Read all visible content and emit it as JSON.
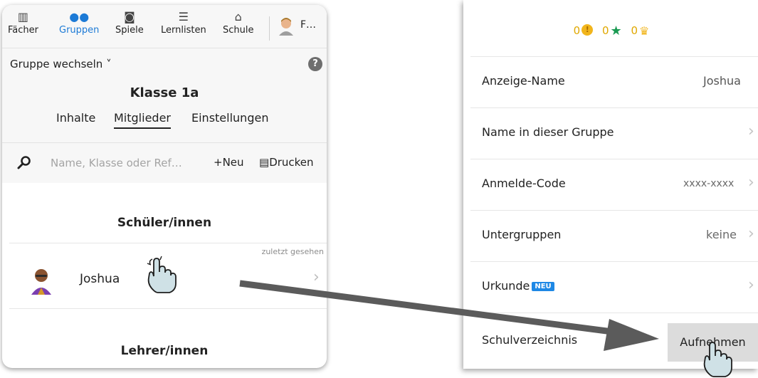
{
  "nav": {
    "items": [
      {
        "label": "Fächer",
        "icon": "books-icon",
        "glyph": "▥"
      },
      {
        "label": "Gruppen",
        "icon": "group-icon",
        "glyph": "●●",
        "active": true
      },
      {
        "label": "Spiele",
        "icon": "gamepad-icon",
        "glyph": "◙"
      },
      {
        "label": "Lernlisten",
        "icon": "list-icon",
        "glyph": "☰"
      },
      {
        "label": "Schule",
        "icon": "school-icon",
        "glyph": "⌂"
      }
    ],
    "user_label": "F…"
  },
  "group_switch": "Gruppe wechseln ˅",
  "help": "?",
  "class_title": "Klasse 1a",
  "tabs": [
    "Inhalte",
    "Mitglieder",
    "Einstellungen"
  ],
  "search": {
    "placeholder": "Name, Klasse oder Ref…"
  },
  "actions": {
    "new": "+Neu",
    "print": "Drucken"
  },
  "students": {
    "heading": "Schüler/innen",
    "last_seen_label": "zuletzt gesehen",
    "items": [
      {
        "name": "Joshua"
      }
    ]
  },
  "teachers": {
    "heading": "Lehrer/innen"
  },
  "profile": {
    "stats": {
      "coins": "0",
      "stars": "0",
      "trophies": "0"
    },
    "rows": [
      {
        "label": "Anzeige-Name",
        "value": "Joshua"
      },
      {
        "label": "Name in dieser Gruppe",
        "value": ""
      },
      {
        "label": "Anmelde-Code",
        "value": "xxxx-xxxx"
      },
      {
        "label": "Untergruppen",
        "value": "keine"
      },
      {
        "label": "Urkunde",
        "badge": "NEU",
        "value": ""
      },
      {
        "label": "Schulverzeichnis",
        "button": "Aufnehmen"
      }
    ]
  },
  "colors": {
    "accent": "#1c7ad6",
    "badge": "#1e88e5",
    "coin": "#f1b51c",
    "star": "#1a9a52",
    "arrow": "#5b5b5b"
  }
}
